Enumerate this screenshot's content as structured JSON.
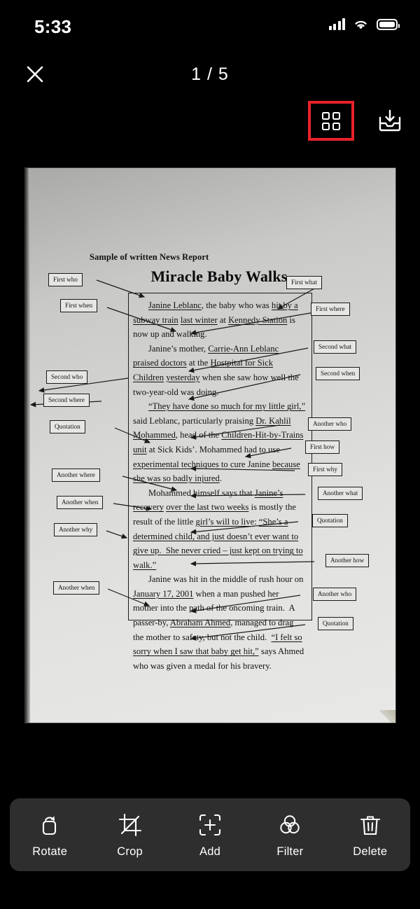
{
  "status_bar": {
    "time": "5:33",
    "icons": [
      "cellular-signal-icon",
      "wifi-icon",
      "battery-icon"
    ]
  },
  "top_bar": {
    "close_label": "close-icon",
    "page_indicator": "1 / 5",
    "grid_button_label": "grid-view-icon",
    "grid_button_highlight_color": "#e8222a",
    "save_button_label": "save-to-files-icon"
  },
  "document": {
    "subtitle": "Sample of written News Report",
    "title": "Miracle Baby Walks",
    "paragraphs": [
      "Janine Leblanc, the baby who was hit by a subway train last winter at Kennedy Station is now up and walking.",
      "Janine’s mother, Carrie-Ann Leblanc praised doctors at the Hostpital for Sick Children yesterday when she saw how well the two-year-old was doing.",
      "“They have done so much for my little girl,” said Leblanc, particularly praising Dr. Kahlil Mohammed, head of the Children-Hit-by-Trains unit at Sick Kids’. Mohammed had to use experimental techniques to cure Janine because she was so badly injured.",
      "Mohammed himself says that Janine’s recovery over the last two weeks is mostly the result of the little girl’s will to live:  “She’s a determined child, and just doesn’t ever want to give up.  She never cried – just kept on trying to walk.”",
      "Janine was hit in the middle of rush hour on January 17, 2001 when a man pushed her mother into the path of the oncoming train.  A passer-by, Abraham Ahmed, managed to drag the mother to safety, but not the child.  “I felt so sorry when I saw that baby get hit,” says Ahmed who was given a medal for his bravery."
    ],
    "annotations_left": [
      {
        "id": "first-who",
        "label": "First who"
      },
      {
        "id": "first-when",
        "label": "First when"
      },
      {
        "id": "second-who",
        "label": "Second who"
      },
      {
        "id": "second-where",
        "label": "Second where"
      },
      {
        "id": "quotation-1",
        "label": "Quotation"
      },
      {
        "id": "another-where",
        "label": "Another where"
      },
      {
        "id": "another-when-1",
        "label": "Another when"
      },
      {
        "id": "another-why",
        "label": "Another why"
      },
      {
        "id": "another-when-2",
        "label": "Another when"
      }
    ],
    "annotations_right": [
      {
        "id": "first-what",
        "label": "First what"
      },
      {
        "id": "first-where",
        "label": "First where"
      },
      {
        "id": "second-what",
        "label": "Second what"
      },
      {
        "id": "second-when",
        "label": "Second when"
      },
      {
        "id": "another-who-1",
        "label": "Another who"
      },
      {
        "id": "first-how",
        "label": "First how"
      },
      {
        "id": "first-why",
        "label": "First why"
      },
      {
        "id": "another-what",
        "label": "Another what"
      },
      {
        "id": "quotation-2",
        "label": "Quotation"
      },
      {
        "id": "another-how",
        "label": "Another how"
      },
      {
        "id": "another-who-2",
        "label": "Another who"
      },
      {
        "id": "quotation-3",
        "label": "Quotation"
      }
    ]
  },
  "toolbar": {
    "items": [
      {
        "id": "rotate",
        "label": "Rotate",
        "icon": "rotate-icon"
      },
      {
        "id": "crop",
        "label": "Crop",
        "icon": "crop-icon"
      },
      {
        "id": "add",
        "label": "Add",
        "icon": "add-page-icon"
      },
      {
        "id": "filter",
        "label": "Filter",
        "icon": "filter-icon"
      },
      {
        "id": "delete",
        "label": "Delete",
        "icon": "trash-icon"
      }
    ]
  }
}
